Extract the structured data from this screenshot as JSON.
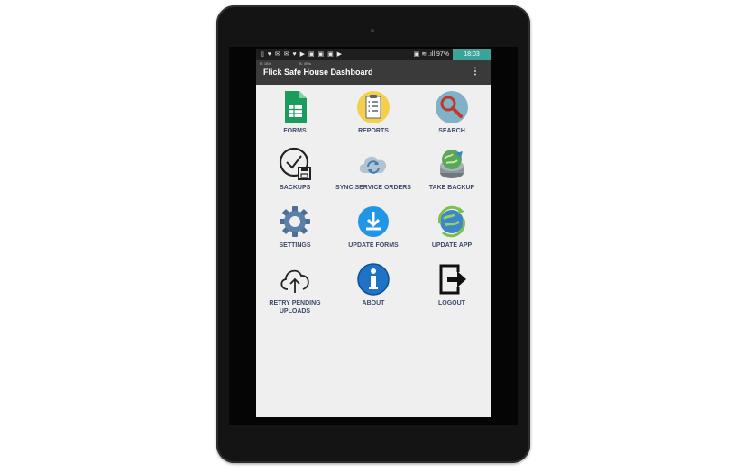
{
  "status_bar": {
    "left_icons": "▯ ♥ ✉ ✉ ♥ ▶ ▣ ▣ ▣ ▶",
    "right_indicators": "▣ ≋ .ıll 97%",
    "time": "18:03"
  },
  "app_bar": {
    "speed_a": "B: 1B/s",
    "speed_b": "B: 0B/s",
    "title": "Flick Safe House Dashboard",
    "overflow": "⋮"
  },
  "tiles": [
    {
      "label": "FORMS",
      "icon": "forms-icon"
    },
    {
      "label": "REPORTS",
      "icon": "reports-icon"
    },
    {
      "label": "SEARCH",
      "icon": "search-icon"
    },
    {
      "label": "BACKUPS",
      "icon": "backups-icon"
    },
    {
      "label": "SYNC SERVICE ORDERS",
      "icon": "sync-icon"
    },
    {
      "label": "TAKE BACKUP",
      "icon": "take-backup-icon"
    },
    {
      "label": "SETTINGS",
      "icon": "gear-icon"
    },
    {
      "label": "UPDATE FORMS",
      "icon": "download-icon"
    },
    {
      "label": "UPDATE APP",
      "icon": "update-app-icon"
    },
    {
      "label": "RETRY PENDING",
      "label2": "UPLOADS",
      "icon": "cloud-upload-icon"
    },
    {
      "label": "ABOUT",
      "icon": "info-icon"
    },
    {
      "label": "LOGOUT",
      "icon": "logout-icon"
    }
  ],
  "colors": {
    "accent_teal": "#3aa39a",
    "app_bar": "#3a3a3a",
    "label_text": "#3d4a6b",
    "screen_bg": "#efefef"
  }
}
